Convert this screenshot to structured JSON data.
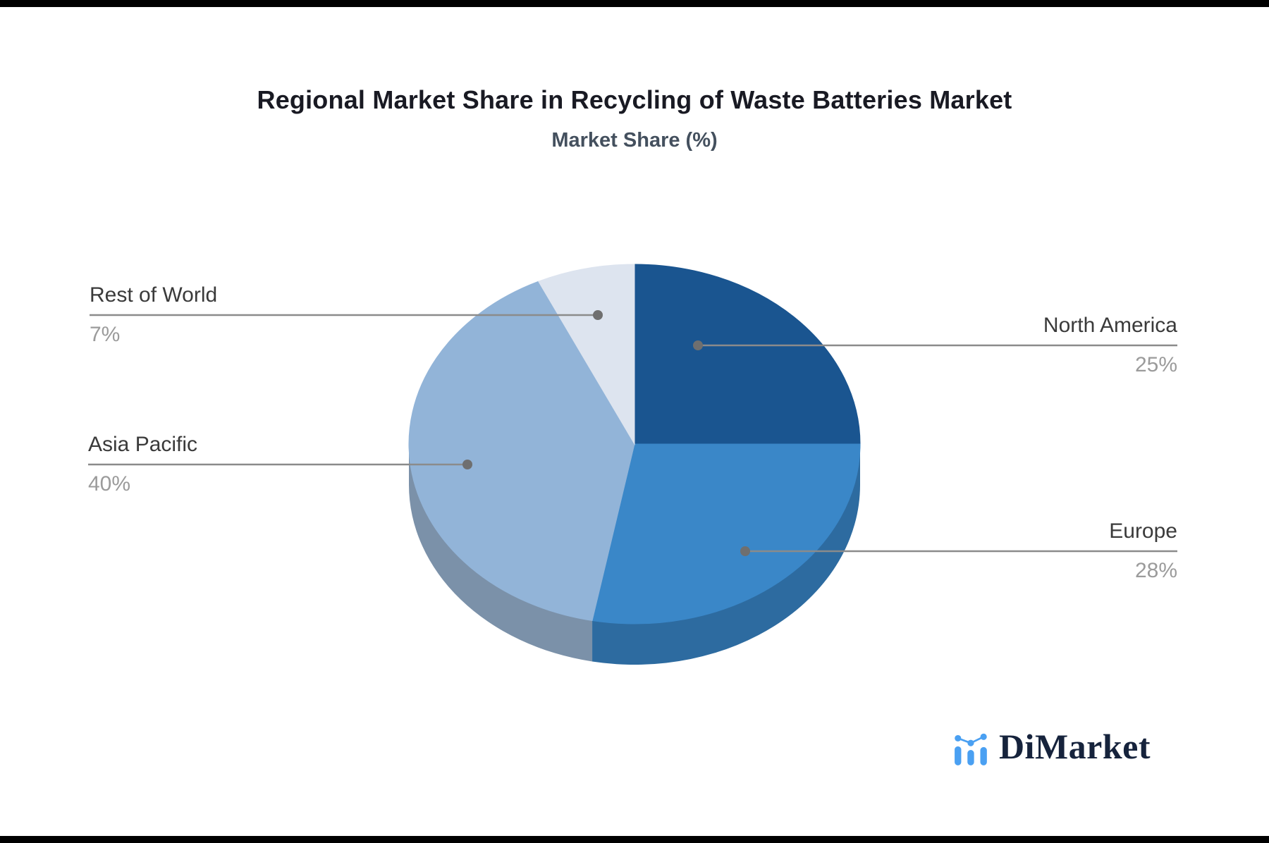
{
  "header": {
    "title": "Regional Market Share in Recycling of Waste Batteries Market",
    "subtitle": "Market Share (%)"
  },
  "chart_data": {
    "type": "pie",
    "style": "3d",
    "title": "Regional Market Share in Recycling of Waste Batteries Market",
    "subtitle": "Market Share (%)",
    "unit": "%",
    "start_angle_deg": -90,
    "direction": "clockwise",
    "legend_position": "callout-labels",
    "slices": [
      {
        "label": "North America",
        "value": 25,
        "value_label": "25%",
        "color": "#1a5590",
        "side_color": "#15446f"
      },
      {
        "label": "Europe",
        "value": 28,
        "value_label": "28%",
        "color": "#3a87c8",
        "side_color": "#2d6ba0"
      },
      {
        "label": "Asia Pacific",
        "value": 40,
        "value_label": "40%",
        "color": "#92b4d8",
        "side_color": "#7b91a9"
      },
      {
        "label": "Rest of World",
        "value": 7,
        "value_label": "7%",
        "color": "#dde4ef",
        "side_color": "#b9c3d3"
      }
    ]
  },
  "branding": {
    "logo_text": "DiMarket",
    "logo_icon": "bar-line-chart-icon",
    "logo_text_color": "#16233c",
    "logo_icon_color": "#4aa0f2"
  },
  "style": {
    "background": "#ffffff",
    "edge_bar_color": "#000000",
    "title_color": "#191a23",
    "subtitle_color": "#44505e",
    "callout_line_color": "#8b8b8b",
    "callout_dot_color": "#6f6f6f",
    "callout_label_color": "#3a3a3a",
    "callout_value_color": "#9b9b9b"
  }
}
